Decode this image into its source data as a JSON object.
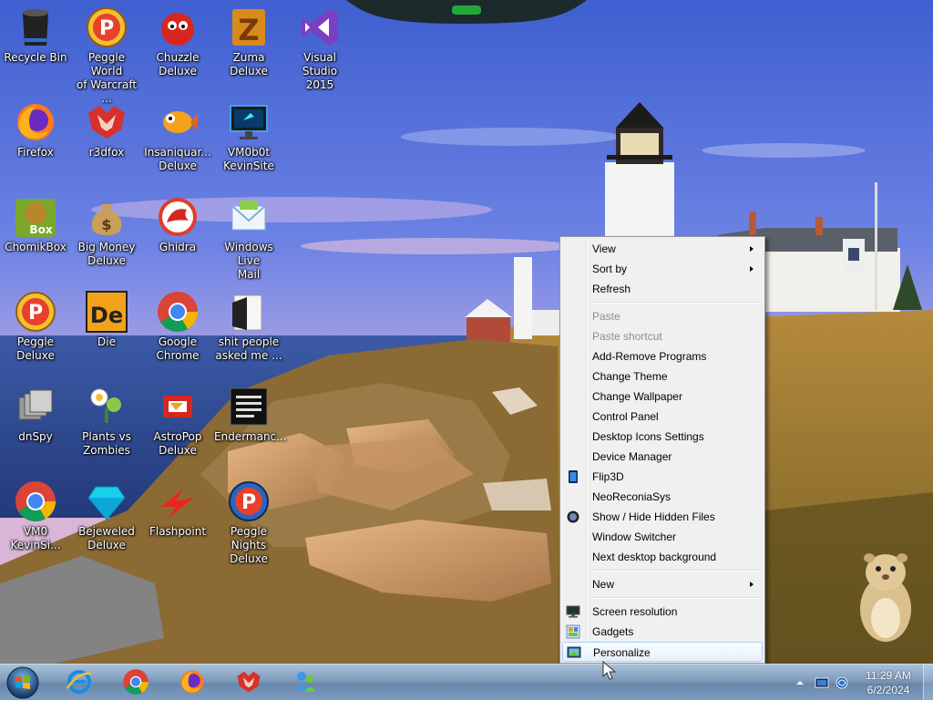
{
  "desktop_icons": [
    {
      "id": "recycle-bin",
      "label": "Recycle Bin",
      "icon": "recycle-bin-icon"
    },
    {
      "id": "peggle-wow",
      "label": "Peggle World\nof Warcraft ...",
      "icon": "peggle-icon"
    },
    {
      "id": "chuzzle",
      "label": "Chuzzle\nDeluxe",
      "icon": "chuzzle-icon"
    },
    {
      "id": "zuma",
      "label": "Zuma Deluxe",
      "icon": "zuma-icon"
    },
    {
      "id": "visual-studio",
      "label": "Visual Studio\n2015",
      "icon": "visual-studio-icon"
    },
    {
      "id": "firefox",
      "label": "Firefox",
      "icon": "firefox-icon"
    },
    {
      "id": "r3dfox",
      "label": "r3dfox",
      "icon": "r3dfox-icon"
    },
    {
      "id": "insaniquarium",
      "label": "Insaniquar...\nDeluxe",
      "icon": "fish-icon"
    },
    {
      "id": "vm0b0t",
      "label": "VM0b0t\nKevinSite",
      "icon": "monitor-icon"
    },
    {
      "id": "chomikbox",
      "label": "ChomikBox",
      "icon": "chomikbox-icon"
    },
    {
      "id": "big-money",
      "label": "Big Money\nDeluxe",
      "icon": "money-bag-icon"
    },
    {
      "id": "ghidra",
      "label": "Ghidra",
      "icon": "ghidra-icon"
    },
    {
      "id": "windows-live-mail",
      "label": "Windows Live\nMail",
      "icon": "mail-icon"
    },
    {
      "id": "peggle-deluxe",
      "label": "Peggle Deluxe",
      "icon": "peggle-icon"
    },
    {
      "id": "die",
      "label": "Die",
      "icon": "die-icon"
    },
    {
      "id": "google-chrome",
      "label": "Google\nChrome",
      "icon": "chrome-icon"
    },
    {
      "id": "folder",
      "label": "shit people\nasked me ...",
      "icon": "folder-icon"
    },
    {
      "id": "dnspy",
      "label": "dnSpy",
      "icon": "dnspy-icon"
    },
    {
      "id": "pvz",
      "label": "Plants vs\nZombies",
      "icon": "plant-icon"
    },
    {
      "id": "astropop",
      "label": "AstroPop\nDeluxe",
      "icon": "astropop-icon"
    },
    {
      "id": "endermanch",
      "label": "Endermanc...",
      "icon": "terminal-icon"
    },
    {
      "id": "vm0-kevinsi",
      "label": "VM0\nKevinSi...",
      "icon": "chrome-icon"
    },
    {
      "id": "bejeweled",
      "label": "Bejeweled\nDeluxe",
      "icon": "gem-icon"
    },
    {
      "id": "flashpoint",
      "label": "Flashpoint",
      "icon": "flashpoint-icon"
    },
    {
      "id": "peggle-nights",
      "label": "Peggle Nights\nDeluxe",
      "icon": "peggle-nights-icon"
    }
  ],
  "context_menu": {
    "items": [
      {
        "label": "View",
        "submenu": true
      },
      {
        "label": "Sort by",
        "submenu": true
      },
      {
        "label": "Refresh"
      },
      {
        "separator": true
      },
      {
        "label": "Paste",
        "disabled": true
      },
      {
        "label": "Paste shortcut",
        "disabled": true
      },
      {
        "label": "Add-Remove Programs"
      },
      {
        "label": "Change Theme"
      },
      {
        "label": "Change Wallpaper"
      },
      {
        "label": "Control Panel"
      },
      {
        "label": "Desktop Icons Settings"
      },
      {
        "label": "Device Manager"
      },
      {
        "label": "Flip3D",
        "icon": "flip3d-icon"
      },
      {
        "label": "NeoReconiaSys"
      },
      {
        "label": "Show / Hide Hidden Files",
        "icon": "globe-icon"
      },
      {
        "label": "Window Switcher"
      },
      {
        "label": "Next desktop background"
      },
      {
        "separator": true
      },
      {
        "label": "New",
        "submenu": true
      },
      {
        "separator": true
      },
      {
        "label": "Screen resolution",
        "icon": "screen-icon"
      },
      {
        "label": "Gadgets",
        "icon": "gadgets-icon"
      },
      {
        "label": "Personalize",
        "icon": "personalize-icon",
        "hover": true
      }
    ]
  },
  "taskbar": {
    "pinned": [
      {
        "name": "internet-explorer",
        "icon": "ie-icon"
      },
      {
        "name": "chrome",
        "icon": "chrome-icon"
      },
      {
        "name": "firefox",
        "icon": "firefox-icon"
      },
      {
        "name": "r3dfox",
        "icon": "r3dfox-icon"
      },
      {
        "name": "windows-live-messenger",
        "icon": "messenger-icon"
      }
    ],
    "clock": {
      "time": "11:29 AM",
      "date": "6/2/2024"
    }
  },
  "colors": {
    "accent": "#a8d0f6",
    "taskbar": "#7e9bbc"
  }
}
